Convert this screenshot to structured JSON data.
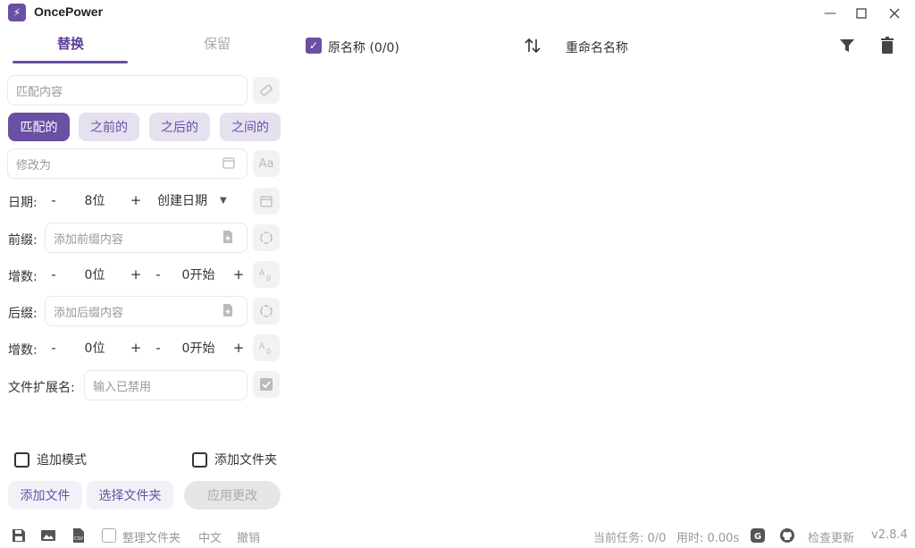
{
  "app": {
    "title": "OncePower"
  },
  "tabs": {
    "replace": "替换",
    "keep": "保留"
  },
  "match": {
    "placeholder": "匹配内容"
  },
  "modes": [
    "匹配的",
    "之前的",
    "之后的",
    "之间的"
  ],
  "modify": {
    "placeholder": "修改为",
    "case_label": "Aa"
  },
  "date": {
    "label": "日期:",
    "digits": "8位",
    "type": "创建日期"
  },
  "prefix": {
    "label": "前缀:",
    "placeholder": "添加前缀内容"
  },
  "increment1": {
    "label": "增数:",
    "digits": "0位",
    "start": "0开始"
  },
  "suffix": {
    "label": "后缀:",
    "placeholder": "添加后缀内容"
  },
  "increment2": {
    "label": "增数:",
    "digits": "0位",
    "start": "0开始"
  },
  "extension": {
    "label": "文件扩展名:",
    "placeholder": "输入已禁用"
  },
  "options": {
    "append_mode": "追加模式",
    "add_folder": "添加文件夹"
  },
  "actions": {
    "add_file": "添加文件",
    "select_folder": "选择文件夹",
    "apply": "应用更改"
  },
  "table": {
    "original_name": "原名称 (0/0)",
    "renamed_name": "重命名名称"
  },
  "status": {
    "organize_folder": "整理文件夹",
    "language": "中文",
    "undo": "撤销",
    "current_task": "当前任务: 0/0",
    "elapsed": "用时: 0.00s",
    "check_update": "检查更新",
    "version": "v2.8.4"
  },
  "colors": {
    "accent": "#6a4fa3",
    "accent_light": "#e5e1ef"
  },
  "icons": {
    "logo": "lightning-icon",
    "minimize": "minimize-icon",
    "maximize": "maximize-icon",
    "close": "close-icon",
    "ruler": "ruler-icon",
    "calendar": "calendar-icon",
    "file_plus": "file-add-icon",
    "refresh": "refresh-icon",
    "increment": "increment-icon",
    "check": "check-icon",
    "sort": "sort-icon",
    "filter": "filter-icon",
    "trash": "trash-icon",
    "save": "save-icon",
    "image": "image-icon",
    "csv": "csv-icon",
    "g": "g-icon",
    "github": "github-icon"
  }
}
